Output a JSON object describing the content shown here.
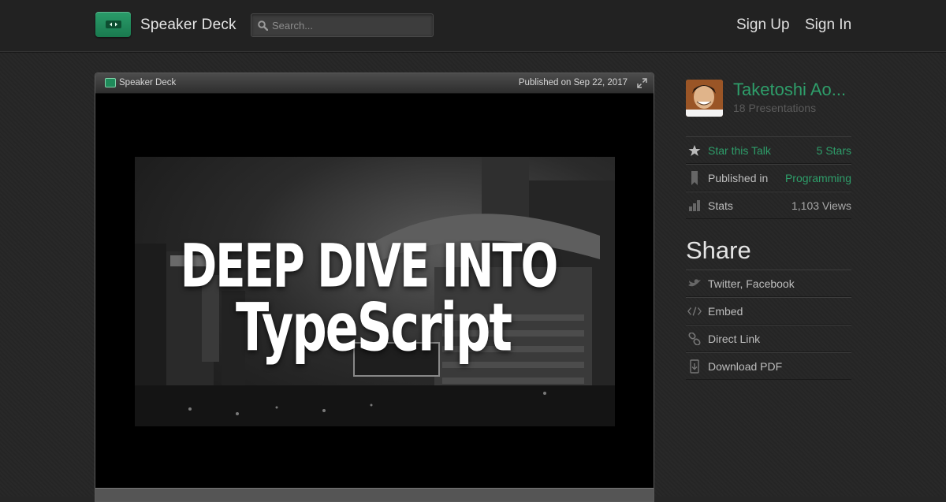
{
  "header": {
    "brand": "Speaker Deck",
    "search_placeholder": "Search...",
    "sign_up": "Sign Up",
    "sign_in": "Sign In"
  },
  "player": {
    "brand": "Speaker Deck",
    "published": "Published on Sep 22, 2017",
    "slide": {
      "line1": "DEEP DIVE INTO",
      "line2": "TypeScript"
    }
  },
  "sidebar": {
    "author": "Taketoshi Ao...",
    "presentations": "18 Presentations",
    "stats_rows": [
      {
        "label": "Star this Talk",
        "value": "5 Stars",
        "icon": "star-icon"
      },
      {
        "label": "Published in",
        "value": "Programming",
        "icon": "bookmark-icon"
      },
      {
        "label": "Stats",
        "value": "1,103 Views",
        "icon": "bar-chart-icon"
      }
    ],
    "share_title": "Share",
    "share_rows": [
      {
        "label": "Twitter, Facebook",
        "icon": "bird-icon"
      },
      {
        "label": "Embed",
        "icon": "code-icon"
      },
      {
        "label": "Direct Link",
        "icon": "link-icon"
      },
      {
        "label": "Download PDF",
        "icon": "download-icon"
      }
    ]
  },
  "colors": {
    "accent": "#2e9e6a",
    "background": "#262626",
    "header_bg": "#222222"
  }
}
